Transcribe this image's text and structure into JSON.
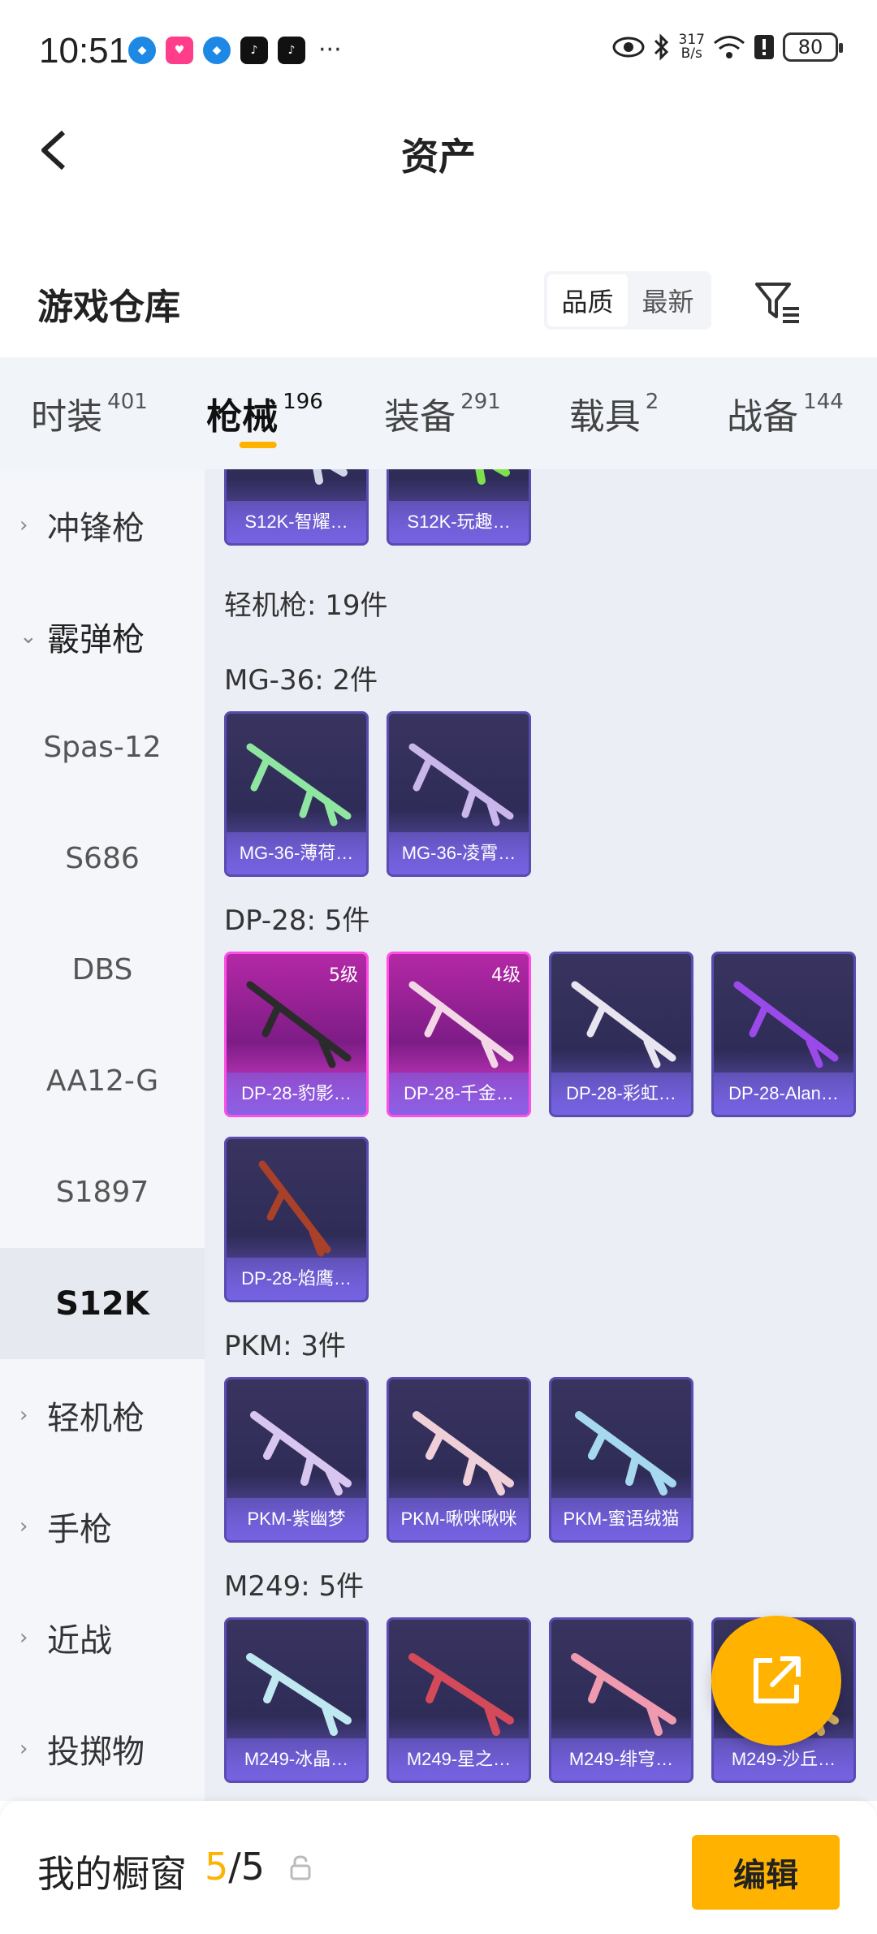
{
  "status_bar": {
    "time": "10:51",
    "more": "···",
    "net_speed_value": "317",
    "net_speed_unit": "B/s",
    "battery": "80"
  },
  "header": {
    "title": "资产",
    "back_icon": "chevron-left-icon"
  },
  "section": {
    "title": "游戏仓库",
    "sort_options": [
      "品质",
      "最新"
    ],
    "sort_selected": "品质",
    "filter_icon": "filter-icon"
  },
  "tabs": [
    {
      "label": "时装",
      "count": "401"
    },
    {
      "label": "枪械",
      "count": "196",
      "active": true
    },
    {
      "label": "装备",
      "count": "291"
    },
    {
      "label": "载具",
      "count": "2"
    },
    {
      "label": "战备",
      "count": "144"
    }
  ],
  "sidebar": {
    "items": [
      {
        "label": "冲锋枪",
        "type": "category",
        "expanded": false
      },
      {
        "label": "霰弹枪",
        "type": "category",
        "expanded": true
      },
      {
        "label": "Spas-12",
        "type": "sub"
      },
      {
        "label": "S686",
        "type": "sub"
      },
      {
        "label": "DBS",
        "type": "sub"
      },
      {
        "label": "AA12-G",
        "type": "sub"
      },
      {
        "label": "S1897",
        "type": "sub"
      },
      {
        "label": "S12K",
        "type": "sub",
        "active": true
      },
      {
        "label": "轻机枪",
        "type": "category",
        "expanded": false
      },
      {
        "label": "手枪",
        "type": "category",
        "expanded": false
      },
      {
        "label": "近战",
        "type": "category",
        "expanded": false
      },
      {
        "label": "投掷物",
        "type": "category",
        "expanded": false
      }
    ]
  },
  "content": {
    "top_cards": [
      {
        "name": "S12K-智耀…",
        "gun_color": "#cfd6e6"
      },
      {
        "name": "S12K-玩趣…",
        "gun_color": "#7ee04a"
      }
    ],
    "category_header": "轻机枪: 19件",
    "groups": [
      {
        "title": "MG-36: 2件",
        "items": [
          {
            "name": "MG-36-薄荷…",
            "gun_color": "#8ee6a0"
          },
          {
            "name": "MG-36-凌霄…",
            "gun_color": "#c9b6ea"
          }
        ]
      },
      {
        "title": "DP-28: 5件",
        "items": [
          {
            "name": "DP-28-豹影…",
            "level": "5级",
            "rarity": "pink",
            "gun_color": "#2b2b2b"
          },
          {
            "name": "DP-28-千金…",
            "level": "4级",
            "rarity": "pink",
            "gun_color": "#f3d7e6"
          },
          {
            "name": "DP-28-彩虹…",
            "gun_color": "#e8e4f0"
          },
          {
            "name": "DP-28-Alan…",
            "gun_color": "#9a4ae8"
          },
          {
            "name": "DP-28-焰鹰…",
            "gun_color": "#a8402a"
          }
        ]
      },
      {
        "title": "PKM: 3件",
        "items": [
          {
            "name": "PKM-紫幽梦",
            "gun_color": "#d8c6f0"
          },
          {
            "name": "PKM-啾咪啾咪",
            "gun_color": "#f0d0d8"
          },
          {
            "name": "PKM-蜜语绒猫",
            "gun_color": "#a6d8f0"
          }
        ]
      },
      {
        "title": "M249: 5件",
        "items": [
          {
            "name": "M249-冰晶…",
            "gun_color": "#bfe8f0"
          },
          {
            "name": "M249-星之…",
            "gun_color": "#d44a5a"
          },
          {
            "name": "M249-绯穹…",
            "gun_color": "#f09ab0"
          },
          {
            "name": "M249-沙丘…",
            "gun_color": "#d8b060"
          }
        ]
      }
    ]
  },
  "fab": {
    "icon": "share-external-icon",
    "color": "#ffb300"
  },
  "bottom": {
    "window_label": "我的橱窗",
    "window_current": "5",
    "window_sep_total": "/5",
    "lock_icon": "lock-icon",
    "edit_label": "编辑"
  },
  "colors": {
    "accent": "#ffb300",
    "card": "#2f2c58",
    "card_pink": "#b428a6"
  }
}
